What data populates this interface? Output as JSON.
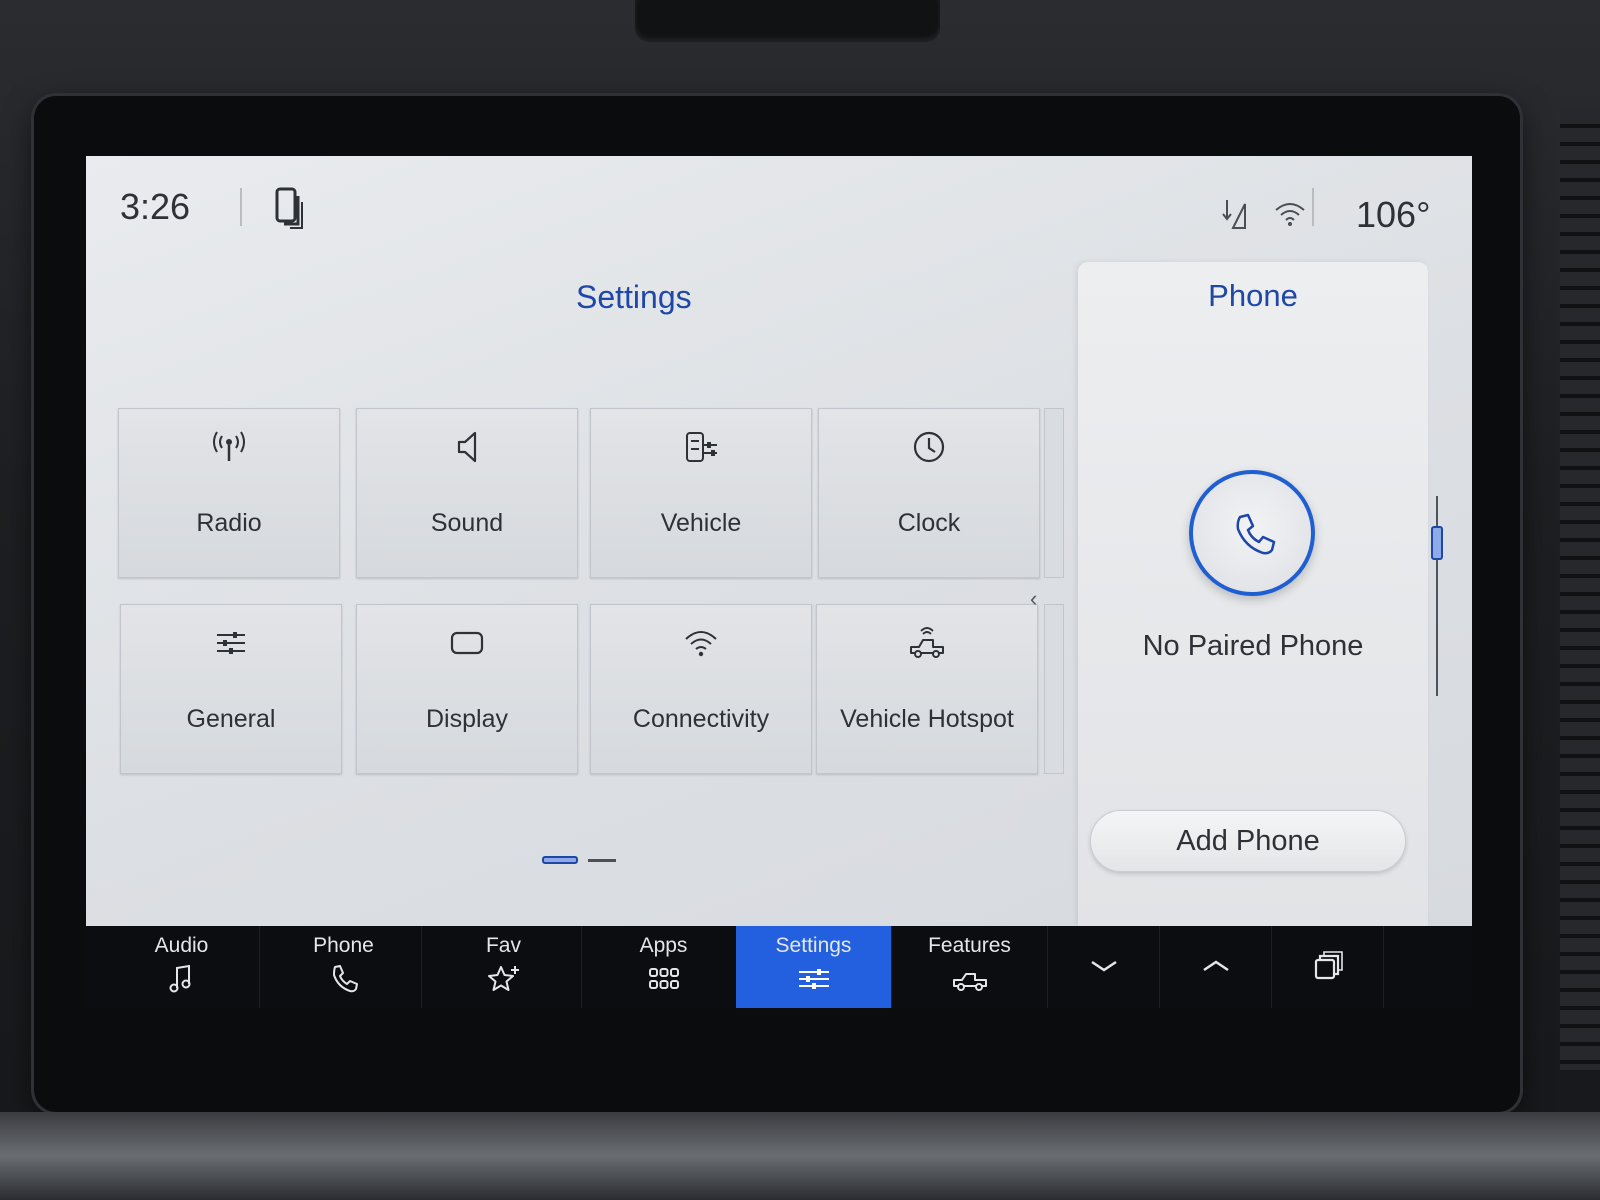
{
  "status_bar": {
    "time": "3:26",
    "temperature": "106°"
  },
  "settings": {
    "title": "Settings",
    "tiles": [
      {
        "label": "Radio",
        "icon": "antenna-icon"
      },
      {
        "label": "Sound",
        "icon": "speaker-icon"
      },
      {
        "label": "Vehicle",
        "icon": "vehicle-settings-icon"
      },
      {
        "label": "Clock",
        "icon": "clock-icon"
      },
      {
        "label": "General",
        "icon": "sliders-icon"
      },
      {
        "label": "Display",
        "icon": "display-icon"
      },
      {
        "label": "Connectivity",
        "icon": "wifi-icon"
      },
      {
        "label": "Vehicle Hotspot",
        "icon": "truck-hotspot-icon"
      }
    ],
    "page_indicator": {
      "current": 1,
      "total": 2
    }
  },
  "phone_panel": {
    "title": "Phone",
    "status": "No Paired Phone",
    "add_button": "Add Phone"
  },
  "bottom_nav": {
    "items": [
      {
        "label": "Audio",
        "icon": "music-note-icon"
      },
      {
        "label": "Phone",
        "icon": "phone-icon"
      },
      {
        "label": "Fav",
        "icon": "star-add-icon"
      },
      {
        "label": "Apps",
        "icon": "apps-grid-icon"
      },
      {
        "label": "Settings",
        "icon": "sliders-icon",
        "active": true
      },
      {
        "label": "Features",
        "icon": "truck-icon"
      }
    ],
    "controls": [
      "chevron-down-icon",
      "chevron-up-icon",
      "copy-windows-icon"
    ]
  },
  "colors": {
    "accent_blue": "#1f47a8",
    "active_tab": "#2360e0",
    "screen_bg": "#e3e5e8",
    "nav_bg": "#0c0d10"
  }
}
